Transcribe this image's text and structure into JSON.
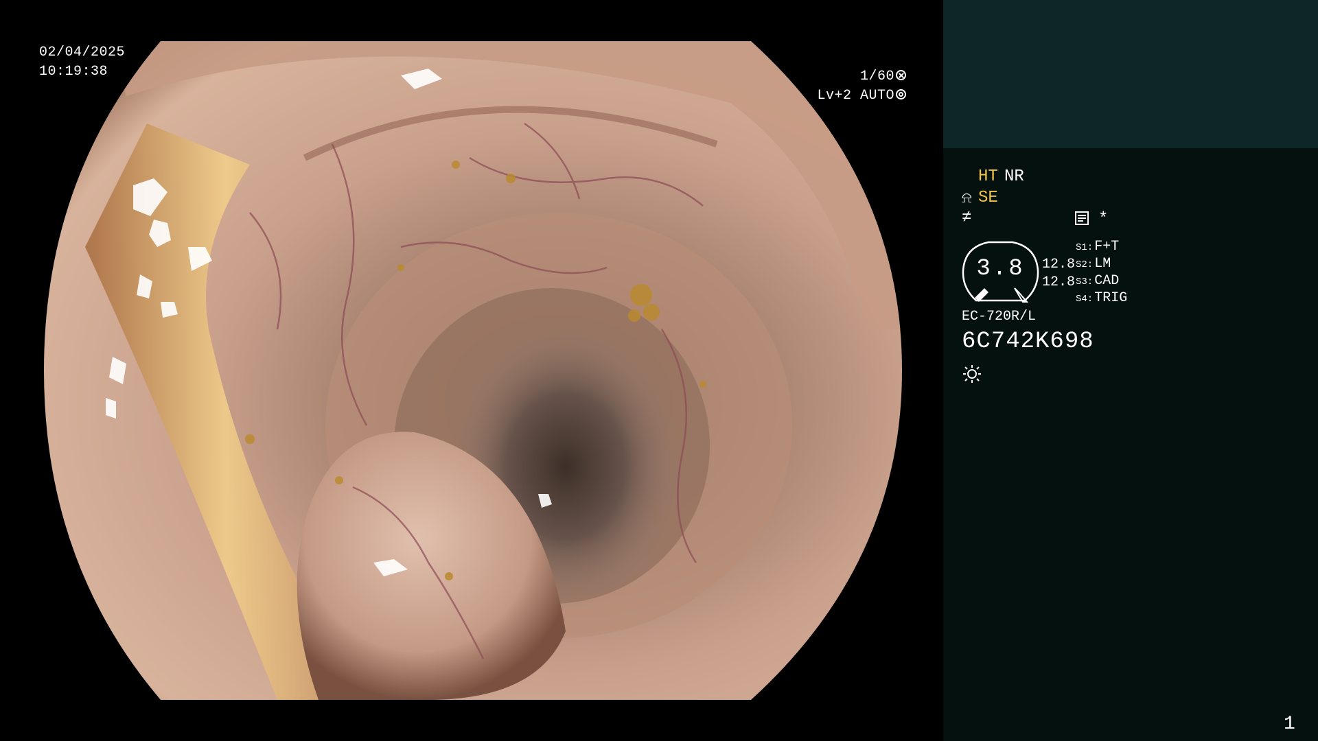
{
  "osd": {
    "date": "02/04/2025",
    "time": "10:19:38",
    "shutter": "1/60",
    "shutter_icon": "aperture-cross-icon",
    "level": "Lv+2 AUTO",
    "level_icon": "iris-ring-icon"
  },
  "panel": {
    "ht": "HT",
    "nr": "NR",
    "se": "SE",
    "se_icon_glyph": "⍾",
    "slash_glyph": "≠",
    "asterisk": "*",
    "gauge_value": "3.8",
    "readout_1": "12.8",
    "readout_2": "12.8",
    "switches": [
      {
        "key": "S1:",
        "label": "F+T"
      },
      {
        "key": "S2:",
        "label": "LM"
      },
      {
        "key": "S3:",
        "label": "CAD"
      },
      {
        "key": "S4:",
        "label": "TRIG"
      }
    ],
    "model": "EC-720R/L",
    "serial": "6C742K698",
    "page_number": "1"
  },
  "colors": {
    "panel_top": "#0f2627",
    "panel_main": "#04110f",
    "highlight_yellow": "#f5c54a",
    "mucosa": "#c99a80",
    "lumen": "#4a3a30"
  },
  "icons": {
    "memo": "memo-icon",
    "brightness": "sun-icon",
    "gauge": "gauge-icon"
  }
}
